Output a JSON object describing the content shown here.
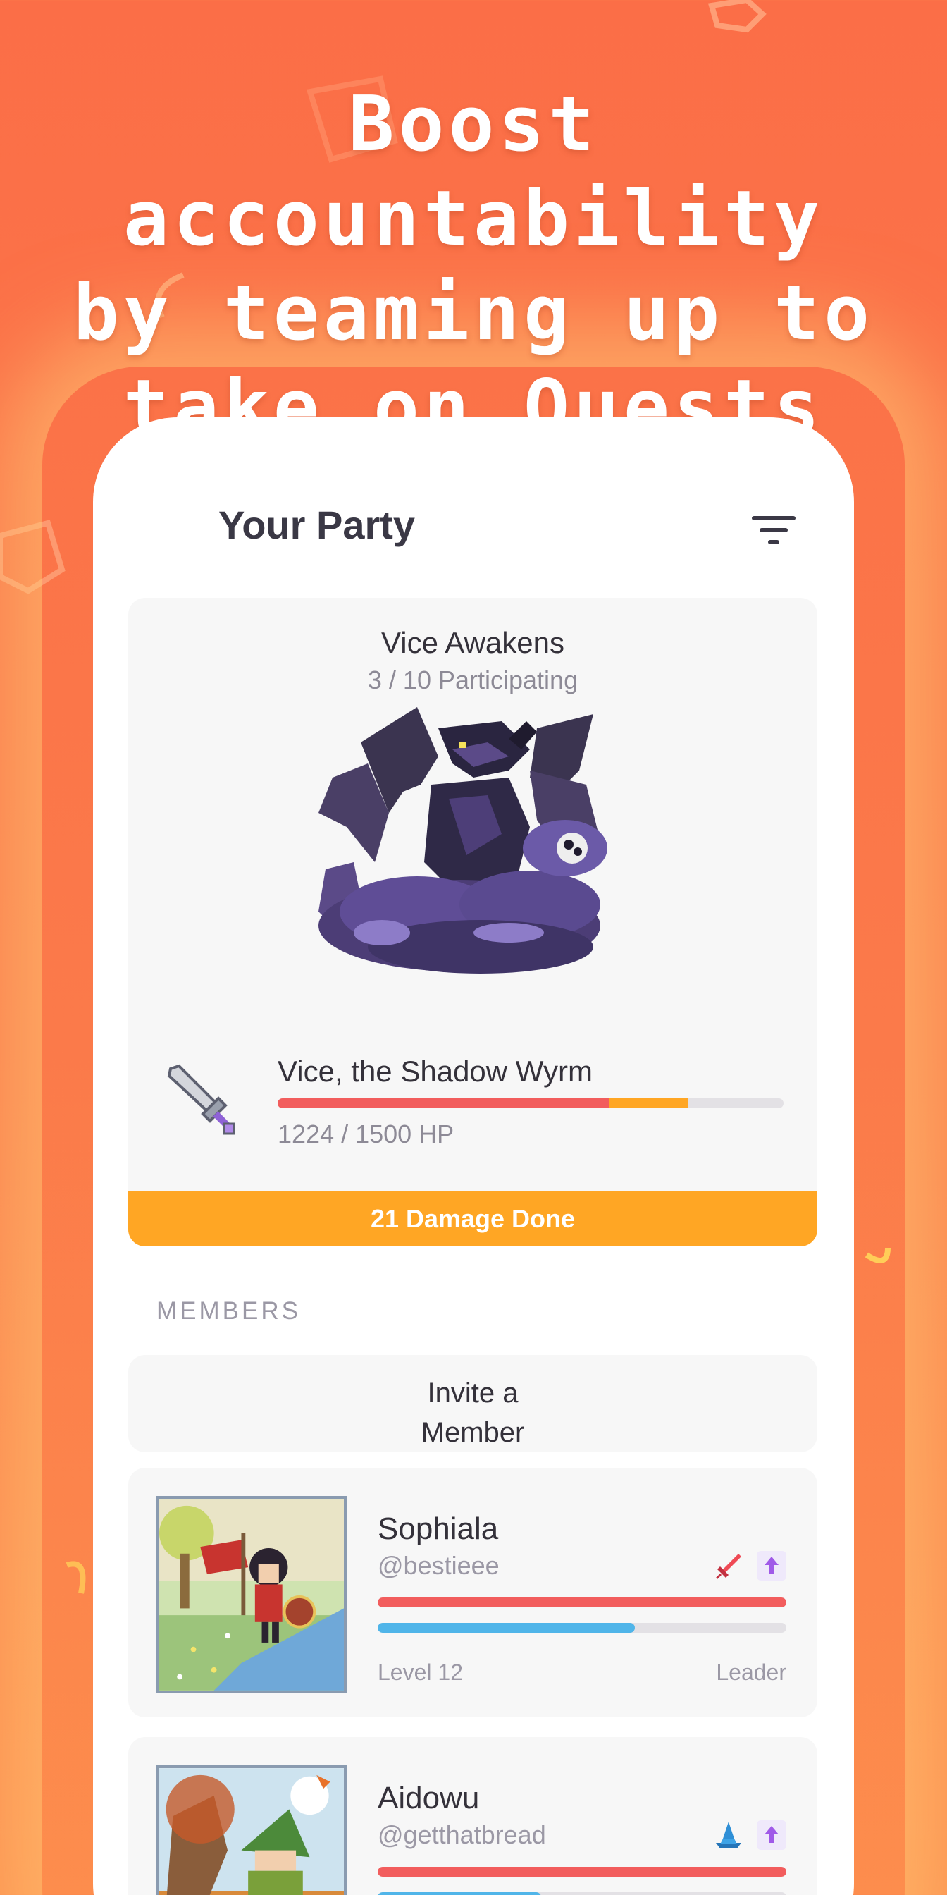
{
  "headline": {
    "line1": "Boost accountability",
    "line2": "by teaming up to",
    "line3": "take on Quests"
  },
  "header": {
    "title": "Your Party",
    "filter_icon": "filter-icon"
  },
  "quest": {
    "title": "Vice Awakens",
    "participating": "3 / 10 Participating",
    "boss_art": "shadow-wyrm-dragon",
    "boss_name": "Vice, the Shadow Wyrm",
    "hp_text": "1224 / 1500 HP",
    "hp_fraction": 0.656,
    "pending_damage_fraction": 0.155,
    "damage_banner": "21 Damage Done"
  },
  "members": {
    "section_label": "MEMBERS",
    "invite_line1": "Invite a",
    "invite_line2": "Member",
    "list": [
      {
        "name": "Sophiala",
        "handle": "@bestieee",
        "class_icon": "sword-icon",
        "health_fraction": 1.0,
        "exp_fraction": 0.63,
        "level": "Level 12",
        "role": "Leader"
      },
      {
        "name": "Aidowu",
        "handle": "@getthatbread",
        "class_icon": "mage-hat-icon",
        "health_fraction": 1.0,
        "exp_fraction": 0.4,
        "level": "",
        "role": ""
      }
    ]
  },
  "colors": {
    "background": "#fb6e47",
    "health": "#f25d5d",
    "experience": "#50b5e9",
    "accent": "#ffa624",
    "text_dark": "#34313a",
    "text_muted": "#9b98a5"
  }
}
